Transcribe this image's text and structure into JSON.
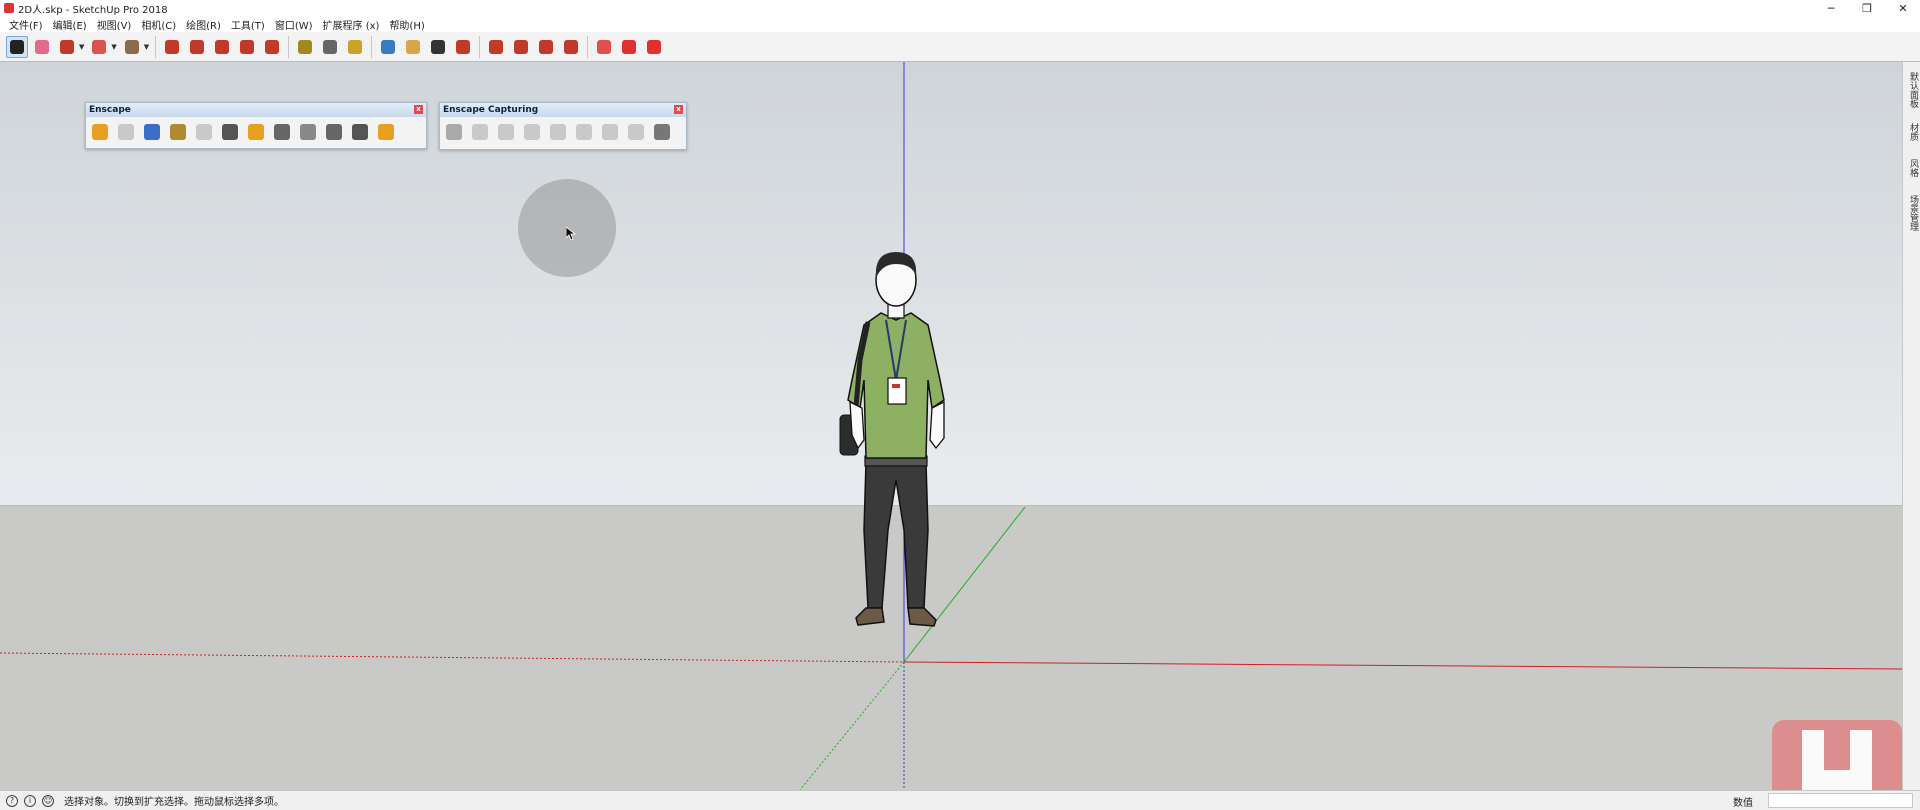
{
  "window": {
    "title": "2D人.skp - SketchUp Pro 2018",
    "minimize_label": "─",
    "restore_label": "❐",
    "close_label": "✕"
  },
  "menus": [
    "文件(F)",
    "编辑(E)",
    "视图(V)",
    "相机(C)",
    "绘图(R)",
    "工具(T)",
    "窗口(W)",
    "扩展程序 (x)",
    "帮助(H)"
  ],
  "toolbar": {
    "tools": [
      {
        "name": "select-tool",
        "icon": "select-arrow-icon",
        "color": "#222222",
        "active": true
      },
      {
        "name": "eraser-tool",
        "icon": "eraser-icon",
        "color": "#e26b8a"
      },
      {
        "name": "line-tool",
        "icon": "pencil-icon",
        "color": "#c0392b",
        "dropdown": true
      },
      {
        "name": "arc-tool",
        "icon": "arc-icon",
        "color": "#d9534f",
        "dropdown": true
      },
      {
        "name": "shape-tool",
        "icon": "rectangle-icon",
        "color": "#8b6b4a",
        "dropdown": true
      },
      {
        "name": "push-pull-tool",
        "icon": "push-pull-icon",
        "color": "#c0392b"
      },
      {
        "name": "offset-tool",
        "icon": "offset-icon",
        "color": "#c0392b"
      },
      {
        "name": "move-tool",
        "icon": "move-icon",
        "color": "#c0392b"
      },
      {
        "name": "rotate-tool",
        "icon": "rotate-icon",
        "color": "#c0392b"
      },
      {
        "name": "scale-tool",
        "icon": "scale-icon",
        "color": "#c0392b"
      },
      {
        "name": "tape-measure-tool",
        "icon": "tape-measure-icon",
        "color": "#a08a20"
      },
      {
        "name": "text-tool",
        "icon": "text-icon",
        "color": "#666666"
      },
      {
        "name": "paint-bucket-tool",
        "icon": "paint-bucket-icon",
        "color": "#c9a227"
      },
      {
        "name": "orbit-tool",
        "icon": "orbit-icon",
        "color": "#3a7bbf"
      },
      {
        "name": "pan-tool",
        "icon": "hand-icon",
        "color": "#d8a64a"
      },
      {
        "name": "zoom-tool",
        "icon": "zoom-icon",
        "color": "#333333"
      },
      {
        "name": "zoom-extents-tool",
        "icon": "zoom-extents-icon",
        "color": "#c0392b"
      },
      {
        "name": "warehouse-tool",
        "icon": "warehouse-icon",
        "color": "#c0392b"
      },
      {
        "name": "extension-warehouse-tool",
        "icon": "extension-icon",
        "color": "#c0392b"
      },
      {
        "name": "send-layout-tool",
        "icon": "layout-icon",
        "color": "#c0392b"
      },
      {
        "name": "extension-manager-tool",
        "icon": "ruby-icon",
        "color": "#c0392b"
      },
      {
        "name": "plugin-tool-1",
        "icon": "plugin-icon",
        "color": "#e05050"
      },
      {
        "name": "plugin-tool-2",
        "icon": "folder-icon",
        "color": "#e03030"
      },
      {
        "name": "plugin-tool-3",
        "icon": "camera-icon",
        "color": "#e03030"
      }
    ]
  },
  "enscape_panel": {
    "title": "Enscape",
    "close_label": "x",
    "buttons": [
      {
        "name": "start-enscape-button",
        "icon": "enscape-start-icon",
        "color": "#e8a020"
      },
      {
        "name": "live-update-button",
        "icon": "refresh-icon",
        "color": "#c9c9c9"
      },
      {
        "name": "sync-views-button",
        "icon": "sync-views-icon",
        "color": "#3a6fc9"
      },
      {
        "name": "light-view-button",
        "icon": "key-icon",
        "color": "#b08a30"
      },
      {
        "name": "screenshot-button",
        "icon": "screenshot-icon",
        "color": "#c9c9c9"
      },
      {
        "name": "vr-headset-button",
        "icon": "vr-icon",
        "color": "#555555"
      },
      {
        "name": "asset-library-button",
        "icon": "asset-library-icon",
        "color": "#e8a020"
      },
      {
        "name": "capture-button",
        "icon": "capture-icon",
        "color": "#666666"
      },
      {
        "name": "audio-button",
        "icon": "speaker-icon",
        "color": "#888888"
      },
      {
        "name": "settings-button",
        "icon": "sliders-icon",
        "color": "#666666"
      },
      {
        "name": "feedback-button",
        "icon": "feedback-icon",
        "color": "#555555"
      },
      {
        "name": "about-button",
        "icon": "info-icon",
        "color": "#e8a020"
      }
    ]
  },
  "capturing_panel": {
    "title": "Enscape Capturing",
    "close_label": "x",
    "buttons": [
      {
        "name": "capture-1-button",
        "icon": "render-icon",
        "color": "#aaaaaa"
      },
      {
        "name": "capture-2-button",
        "icon": "document-icon",
        "color": "#c9c9c9"
      },
      {
        "name": "capture-3-button",
        "icon": "panorama-icon",
        "color": "#c9c9c9"
      },
      {
        "name": "capture-4-button",
        "icon": "panorama-icon",
        "color": "#c9c9c9"
      },
      {
        "name": "capture-5-button",
        "icon": "batch-icon",
        "color": "#c9c9c9"
      },
      {
        "name": "capture-6-button",
        "icon": "batch-icon",
        "color": "#c9c9c9"
      },
      {
        "name": "capture-7-button",
        "icon": "video-icon",
        "color": "#c9c9c9"
      },
      {
        "name": "capture-8-button",
        "icon": "video-icon",
        "color": "#c9c9c9"
      },
      {
        "name": "capture-9-button",
        "icon": "video-editor-icon",
        "color": "#777777"
      }
    ]
  },
  "right_tray": {
    "tabs": [
      "默认面板",
      "材质",
      "风格",
      "场景管理"
    ]
  },
  "statusbar": {
    "hint": "选择对象。切换到扩充选择。拖动鼠标选择多项。",
    "measurements_label": "数值",
    "measurements_value": ""
  },
  "scene": {
    "figure": "person-figure",
    "axis_colors": {
      "blue": "#3a3ad0",
      "red": "#d02020",
      "green": "#20b020"
    }
  }
}
